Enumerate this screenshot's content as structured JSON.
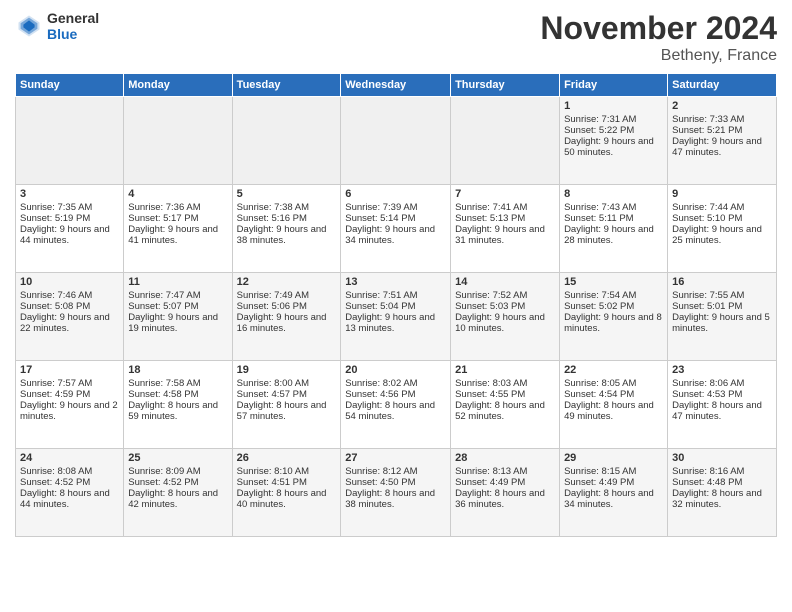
{
  "header": {
    "logo_general": "General",
    "logo_blue": "Blue",
    "month": "November 2024",
    "location": "Betheny, France"
  },
  "days_of_week": [
    "Sunday",
    "Monday",
    "Tuesday",
    "Wednesday",
    "Thursday",
    "Friday",
    "Saturday"
  ],
  "weeks": [
    [
      {
        "day": "",
        "empty": true
      },
      {
        "day": "",
        "empty": true
      },
      {
        "day": "",
        "empty": true
      },
      {
        "day": "",
        "empty": true
      },
      {
        "day": "",
        "empty": true
      },
      {
        "day": "1",
        "sunrise": "Sunrise: 7:31 AM",
        "sunset": "Sunset: 5:22 PM",
        "daylight": "Daylight: 9 hours and 50 minutes."
      },
      {
        "day": "2",
        "sunrise": "Sunrise: 7:33 AM",
        "sunset": "Sunset: 5:21 PM",
        "daylight": "Daylight: 9 hours and 47 minutes."
      }
    ],
    [
      {
        "day": "3",
        "sunrise": "Sunrise: 7:35 AM",
        "sunset": "Sunset: 5:19 PM",
        "daylight": "Daylight: 9 hours and 44 minutes."
      },
      {
        "day": "4",
        "sunrise": "Sunrise: 7:36 AM",
        "sunset": "Sunset: 5:17 PM",
        "daylight": "Daylight: 9 hours and 41 minutes."
      },
      {
        "day": "5",
        "sunrise": "Sunrise: 7:38 AM",
        "sunset": "Sunset: 5:16 PM",
        "daylight": "Daylight: 9 hours and 38 minutes."
      },
      {
        "day": "6",
        "sunrise": "Sunrise: 7:39 AM",
        "sunset": "Sunset: 5:14 PM",
        "daylight": "Daylight: 9 hours and 34 minutes."
      },
      {
        "day": "7",
        "sunrise": "Sunrise: 7:41 AM",
        "sunset": "Sunset: 5:13 PM",
        "daylight": "Daylight: 9 hours and 31 minutes."
      },
      {
        "day": "8",
        "sunrise": "Sunrise: 7:43 AM",
        "sunset": "Sunset: 5:11 PM",
        "daylight": "Daylight: 9 hours and 28 minutes."
      },
      {
        "day": "9",
        "sunrise": "Sunrise: 7:44 AM",
        "sunset": "Sunset: 5:10 PM",
        "daylight": "Daylight: 9 hours and 25 minutes."
      }
    ],
    [
      {
        "day": "10",
        "sunrise": "Sunrise: 7:46 AM",
        "sunset": "Sunset: 5:08 PM",
        "daylight": "Daylight: 9 hours and 22 minutes."
      },
      {
        "day": "11",
        "sunrise": "Sunrise: 7:47 AM",
        "sunset": "Sunset: 5:07 PM",
        "daylight": "Daylight: 9 hours and 19 minutes."
      },
      {
        "day": "12",
        "sunrise": "Sunrise: 7:49 AM",
        "sunset": "Sunset: 5:06 PM",
        "daylight": "Daylight: 9 hours and 16 minutes."
      },
      {
        "day": "13",
        "sunrise": "Sunrise: 7:51 AM",
        "sunset": "Sunset: 5:04 PM",
        "daylight": "Daylight: 9 hours and 13 minutes."
      },
      {
        "day": "14",
        "sunrise": "Sunrise: 7:52 AM",
        "sunset": "Sunset: 5:03 PM",
        "daylight": "Daylight: 9 hours and 10 minutes."
      },
      {
        "day": "15",
        "sunrise": "Sunrise: 7:54 AM",
        "sunset": "Sunset: 5:02 PM",
        "daylight": "Daylight: 9 hours and 8 minutes."
      },
      {
        "day": "16",
        "sunrise": "Sunrise: 7:55 AM",
        "sunset": "Sunset: 5:01 PM",
        "daylight": "Daylight: 9 hours and 5 minutes."
      }
    ],
    [
      {
        "day": "17",
        "sunrise": "Sunrise: 7:57 AM",
        "sunset": "Sunset: 4:59 PM",
        "daylight": "Daylight: 9 hours and 2 minutes."
      },
      {
        "day": "18",
        "sunrise": "Sunrise: 7:58 AM",
        "sunset": "Sunset: 4:58 PM",
        "daylight": "Daylight: 8 hours and 59 minutes."
      },
      {
        "day": "19",
        "sunrise": "Sunrise: 8:00 AM",
        "sunset": "Sunset: 4:57 PM",
        "daylight": "Daylight: 8 hours and 57 minutes."
      },
      {
        "day": "20",
        "sunrise": "Sunrise: 8:02 AM",
        "sunset": "Sunset: 4:56 PM",
        "daylight": "Daylight: 8 hours and 54 minutes."
      },
      {
        "day": "21",
        "sunrise": "Sunrise: 8:03 AM",
        "sunset": "Sunset: 4:55 PM",
        "daylight": "Daylight: 8 hours and 52 minutes."
      },
      {
        "day": "22",
        "sunrise": "Sunrise: 8:05 AM",
        "sunset": "Sunset: 4:54 PM",
        "daylight": "Daylight: 8 hours and 49 minutes."
      },
      {
        "day": "23",
        "sunrise": "Sunrise: 8:06 AM",
        "sunset": "Sunset: 4:53 PM",
        "daylight": "Daylight: 8 hours and 47 minutes."
      }
    ],
    [
      {
        "day": "24",
        "sunrise": "Sunrise: 8:08 AM",
        "sunset": "Sunset: 4:52 PM",
        "daylight": "Daylight: 8 hours and 44 minutes."
      },
      {
        "day": "25",
        "sunrise": "Sunrise: 8:09 AM",
        "sunset": "Sunset: 4:52 PM",
        "daylight": "Daylight: 8 hours and 42 minutes."
      },
      {
        "day": "26",
        "sunrise": "Sunrise: 8:10 AM",
        "sunset": "Sunset: 4:51 PM",
        "daylight": "Daylight: 8 hours and 40 minutes."
      },
      {
        "day": "27",
        "sunrise": "Sunrise: 8:12 AM",
        "sunset": "Sunset: 4:50 PM",
        "daylight": "Daylight: 8 hours and 38 minutes."
      },
      {
        "day": "28",
        "sunrise": "Sunrise: 8:13 AM",
        "sunset": "Sunset: 4:49 PM",
        "daylight": "Daylight: 8 hours and 36 minutes."
      },
      {
        "day": "29",
        "sunrise": "Sunrise: 8:15 AM",
        "sunset": "Sunset: 4:49 PM",
        "daylight": "Daylight: 8 hours and 34 minutes."
      },
      {
        "day": "30",
        "sunrise": "Sunrise: 8:16 AM",
        "sunset": "Sunset: 4:48 PM",
        "daylight": "Daylight: 8 hours and 32 minutes."
      }
    ]
  ]
}
